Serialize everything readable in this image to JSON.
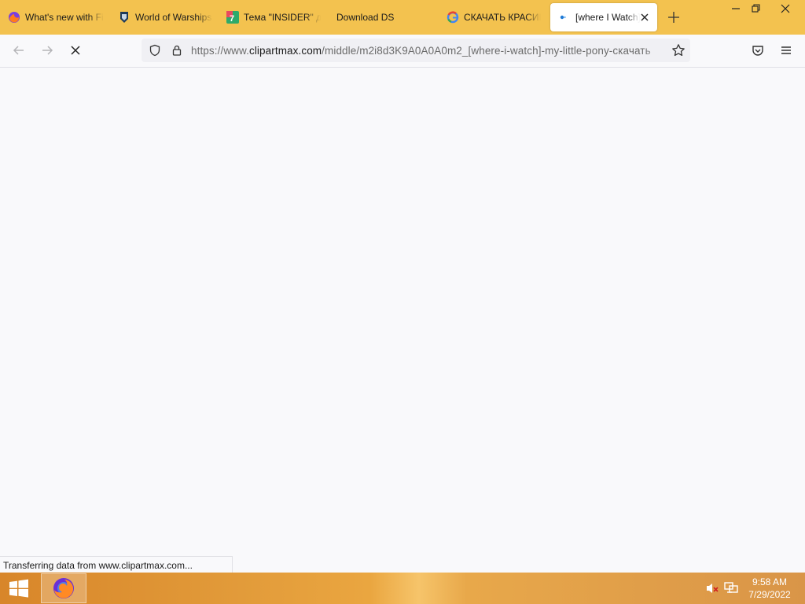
{
  "browser": {
    "tabs": [
      {
        "label": "What's new with Firefox",
        "icon": "firefox-icon"
      },
      {
        "label": "World of Warships",
        "icon": "warships-icon"
      },
      {
        "label": "Тема \"INSIDER\" для",
        "icon": "insider-icon"
      },
      {
        "label": "Download DS",
        "icon": ""
      },
      {
        "label": "СКАЧАТЬ КРАСИВЫЕ",
        "icon": "google-icon"
      },
      {
        "label": "[where I Watch]",
        "icon": "clipartmax-icon",
        "active": true
      }
    ],
    "address_bar": {
      "url_prefix": "https://www.",
      "url_host": "clipartmax.com",
      "url_path": "/middle/m2i8d3K9A0A0A0m2_[where-i-watch]-my-little-pony-скачать"
    },
    "status_text": "Transferring data from www.clipartmax.com..."
  },
  "taskbar": {
    "time": "9:58 AM",
    "date": "7/29/2022"
  },
  "colors": {
    "tabstrip": "#f3c24f",
    "toolbar": "#f9f9fb",
    "taskbar_accent": "#e29b3a"
  }
}
